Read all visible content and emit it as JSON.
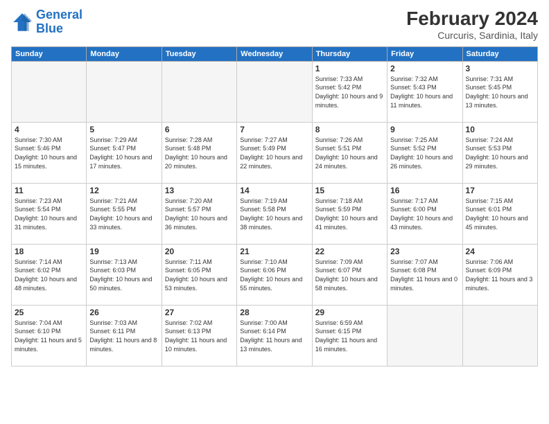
{
  "logo": {
    "line1": "General",
    "line2": "Blue"
  },
  "title": "February 2024",
  "subtitle": "Curcuris, Sardinia, Italy",
  "weekdays": [
    "Sunday",
    "Monday",
    "Tuesday",
    "Wednesday",
    "Thursday",
    "Friday",
    "Saturday"
  ],
  "weeks": [
    [
      {
        "day": "",
        "empty": true
      },
      {
        "day": "",
        "empty": true
      },
      {
        "day": "",
        "empty": true
      },
      {
        "day": "",
        "empty": true
      },
      {
        "day": "1",
        "sunrise": "7:33 AM",
        "sunset": "5:42 PM",
        "daylight": "10 hours and 9 minutes."
      },
      {
        "day": "2",
        "sunrise": "7:32 AM",
        "sunset": "5:43 PM",
        "daylight": "10 hours and 11 minutes."
      },
      {
        "day": "3",
        "sunrise": "7:31 AM",
        "sunset": "5:45 PM",
        "daylight": "10 hours and 13 minutes."
      }
    ],
    [
      {
        "day": "4",
        "sunrise": "7:30 AM",
        "sunset": "5:46 PM",
        "daylight": "10 hours and 15 minutes."
      },
      {
        "day": "5",
        "sunrise": "7:29 AM",
        "sunset": "5:47 PM",
        "daylight": "10 hours and 17 minutes."
      },
      {
        "day": "6",
        "sunrise": "7:28 AM",
        "sunset": "5:48 PM",
        "daylight": "10 hours and 20 minutes."
      },
      {
        "day": "7",
        "sunrise": "7:27 AM",
        "sunset": "5:49 PM",
        "daylight": "10 hours and 22 minutes."
      },
      {
        "day": "8",
        "sunrise": "7:26 AM",
        "sunset": "5:51 PM",
        "daylight": "10 hours and 24 minutes."
      },
      {
        "day": "9",
        "sunrise": "7:25 AM",
        "sunset": "5:52 PM",
        "daylight": "10 hours and 26 minutes."
      },
      {
        "day": "10",
        "sunrise": "7:24 AM",
        "sunset": "5:53 PM",
        "daylight": "10 hours and 29 minutes."
      }
    ],
    [
      {
        "day": "11",
        "sunrise": "7:23 AM",
        "sunset": "5:54 PM",
        "daylight": "10 hours and 31 minutes."
      },
      {
        "day": "12",
        "sunrise": "7:21 AM",
        "sunset": "5:55 PM",
        "daylight": "10 hours and 33 minutes."
      },
      {
        "day": "13",
        "sunrise": "7:20 AM",
        "sunset": "5:57 PM",
        "daylight": "10 hours and 36 minutes."
      },
      {
        "day": "14",
        "sunrise": "7:19 AM",
        "sunset": "5:58 PM",
        "daylight": "10 hours and 38 minutes."
      },
      {
        "day": "15",
        "sunrise": "7:18 AM",
        "sunset": "5:59 PM",
        "daylight": "10 hours and 41 minutes."
      },
      {
        "day": "16",
        "sunrise": "7:17 AM",
        "sunset": "6:00 PM",
        "daylight": "10 hours and 43 minutes."
      },
      {
        "day": "17",
        "sunrise": "7:15 AM",
        "sunset": "6:01 PM",
        "daylight": "10 hours and 45 minutes."
      }
    ],
    [
      {
        "day": "18",
        "sunrise": "7:14 AM",
        "sunset": "6:02 PM",
        "daylight": "10 hours and 48 minutes."
      },
      {
        "day": "19",
        "sunrise": "7:13 AM",
        "sunset": "6:03 PM",
        "daylight": "10 hours and 50 minutes."
      },
      {
        "day": "20",
        "sunrise": "7:11 AM",
        "sunset": "6:05 PM",
        "daylight": "10 hours and 53 minutes."
      },
      {
        "day": "21",
        "sunrise": "7:10 AM",
        "sunset": "6:06 PM",
        "daylight": "10 hours and 55 minutes."
      },
      {
        "day": "22",
        "sunrise": "7:09 AM",
        "sunset": "6:07 PM",
        "daylight": "10 hours and 58 minutes."
      },
      {
        "day": "23",
        "sunrise": "7:07 AM",
        "sunset": "6:08 PM",
        "daylight": "11 hours and 0 minutes."
      },
      {
        "day": "24",
        "sunrise": "7:06 AM",
        "sunset": "6:09 PM",
        "daylight": "11 hours and 3 minutes."
      }
    ],
    [
      {
        "day": "25",
        "sunrise": "7:04 AM",
        "sunset": "6:10 PM",
        "daylight": "11 hours and 5 minutes."
      },
      {
        "day": "26",
        "sunrise": "7:03 AM",
        "sunset": "6:11 PM",
        "daylight": "11 hours and 8 minutes."
      },
      {
        "day": "27",
        "sunrise": "7:02 AM",
        "sunset": "6:13 PM",
        "daylight": "11 hours and 10 minutes."
      },
      {
        "day": "28",
        "sunrise": "7:00 AM",
        "sunset": "6:14 PM",
        "daylight": "11 hours and 13 minutes."
      },
      {
        "day": "29",
        "sunrise": "6:59 AM",
        "sunset": "6:15 PM",
        "daylight": "11 hours and 16 minutes."
      },
      {
        "day": "",
        "empty": true
      },
      {
        "day": "",
        "empty": true
      }
    ]
  ]
}
